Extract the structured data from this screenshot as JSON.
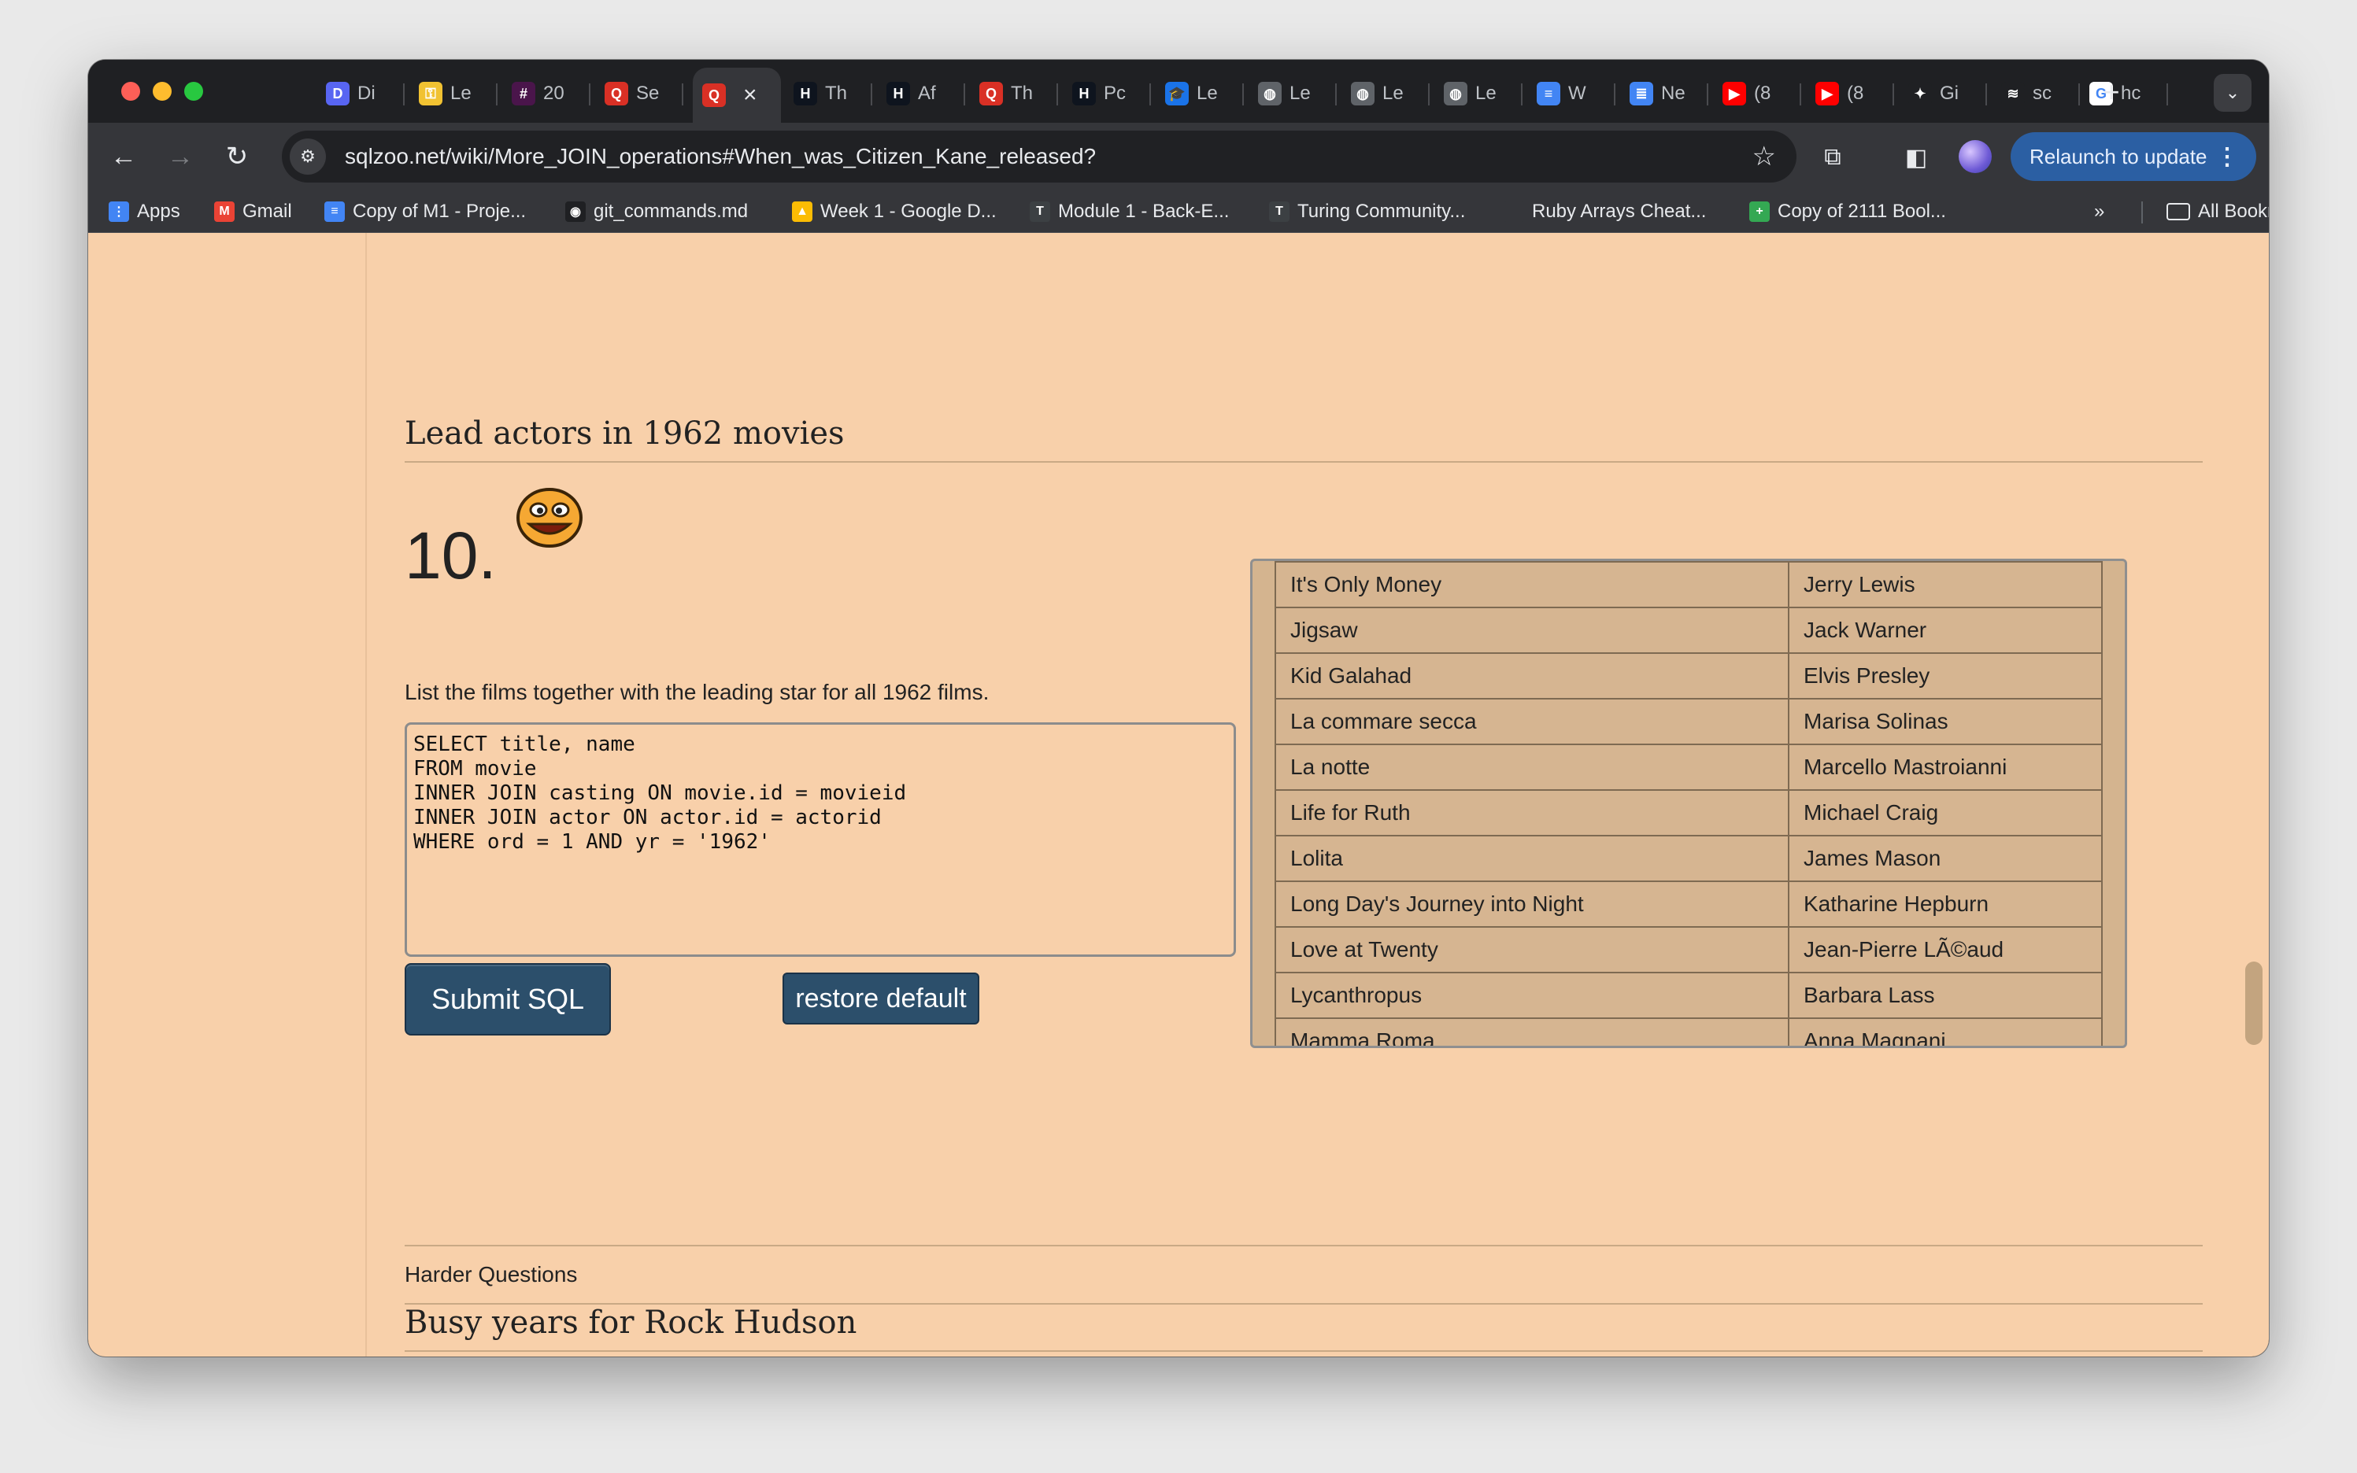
{
  "tabs": [
    {
      "label": "Di",
      "icon": "discord-icon",
      "color": "#5865f2",
      "glyph": "D"
    },
    {
      "label": "Le",
      "icon": "key-icon",
      "color": "#f1c232",
      "glyph": "⚿"
    },
    {
      "label": "20",
      "icon": "slack-icon",
      "color": "#4a154b",
      "glyph": "#"
    },
    {
      "label": "Se",
      "icon": "sqlzoo-icon",
      "color": "#d93025",
      "glyph": "Q"
    },
    {
      "label": "",
      "icon": "sqlzoo-icon",
      "color": "#d93025",
      "glyph": "Q",
      "active": true
    },
    {
      "label": "Th",
      "icon": "hackerrank-icon",
      "color": "#0e141e",
      "glyph": "H"
    },
    {
      "label": "Af",
      "icon": "hackerrank-icon",
      "color": "#0e141e",
      "glyph": "H"
    },
    {
      "label": "Th",
      "icon": "sqlzoo-icon",
      "color": "#d93025",
      "glyph": "Q"
    },
    {
      "label": "Pc",
      "icon": "hackerrank-icon",
      "color": "#0e141e",
      "glyph": "H"
    },
    {
      "label": "Le",
      "icon": "graduation-cap-icon",
      "color": "#1a73e8",
      "glyph": "🎓"
    },
    {
      "label": "Le",
      "icon": "globe-icon",
      "color": "#5f6368",
      "glyph": "◍"
    },
    {
      "label": "Le",
      "icon": "globe-icon",
      "color": "#5f6368",
      "glyph": "◍"
    },
    {
      "label": "Le",
      "icon": "globe-icon",
      "color": "#5f6368",
      "glyph": "◍"
    },
    {
      "label": "W",
      "icon": "google-docs-icon",
      "color": "#4285f4",
      "glyph": "≡"
    },
    {
      "label": "Ne",
      "icon": "database-icon",
      "color": "#4285f4",
      "glyph": "≣"
    },
    {
      "label": "(8",
      "icon": "youtube-icon",
      "color": "#ff0000",
      "glyph": "▶"
    },
    {
      "label": "(8",
      "icon": "youtube-icon",
      "color": "#ff0000",
      "glyph": "▶"
    },
    {
      "label": "Gi",
      "icon": "gemini-icon",
      "color": "#1f2023",
      "glyph": "✦"
    },
    {
      "label": "sc",
      "icon": "stackoverflow-icon",
      "color": "#1f2023",
      "glyph": "≋"
    },
    {
      "label": "hc",
      "icon": "google-icon",
      "color": "#ffffff",
      "glyph": "G"
    }
  ],
  "toolbar": {
    "url": "sqlzoo.net/wiki/More_JOIN_operations#When_was_Citizen_Kane_released?",
    "relaunch_label": "Relaunch to update"
  },
  "bookmarks": [
    {
      "label": "Apps",
      "icon": "apps-grid-icon",
      "color": "#4285f4",
      "glyph": "⋮"
    },
    {
      "label": "Gmail",
      "icon": "gmail-icon",
      "color": "#ea4335",
      "glyph": "M"
    },
    {
      "label": "Copy of M1 - Proje...",
      "icon": "google-docs-icon",
      "color": "#4285f4",
      "glyph": "≡"
    },
    {
      "label": "git_commands.md",
      "icon": "github-icon",
      "color": "#1f2023",
      "glyph": "◉"
    },
    {
      "label": "Week 1 - Google D...",
      "icon": "google-drive-icon",
      "color": "#fbbc04",
      "glyph": "▲"
    },
    {
      "label": "Module 1 - Back-E...",
      "icon": "turing-icon",
      "color": "#3c4043",
      "glyph": "T"
    },
    {
      "label": "Turing Community...",
      "icon": "turing-icon",
      "color": "#3c4043",
      "glyph": "T"
    },
    {
      "label": "Ruby Arrays Cheat...",
      "icon": "blank-page-icon",
      "color": "#35363a",
      "glyph": ""
    },
    {
      "label": "Copy of 2111 Bool...",
      "icon": "google-sheets-icon",
      "color": "#34a853",
      "glyph": "+"
    }
  ],
  "bookmarks_overflow": "»",
  "all_bookmarks_label": "All Bookmarks",
  "content": {
    "section_title": "Lead actors in 1962 movies",
    "question_number": "10.",
    "question_text": "List the films together with the leading star for all 1962 films.",
    "sql": "SELECT title, name\nFROM movie\nINNER JOIN casting ON movie.id = movieid\nINNER JOIN actor ON actor.id = actorid\nWHERE ord = 1 AND yr = '1962'",
    "submit_label": "Submit SQL",
    "restore_label": "restore default",
    "results": [
      [
        "It's Only Money",
        "Jerry Lewis"
      ],
      [
        "Jigsaw",
        "Jack Warner"
      ],
      [
        "Kid Galahad",
        "Elvis Presley"
      ],
      [
        "La commare secca",
        "Marisa Solinas"
      ],
      [
        "La notte",
        "Marcello Mastroianni"
      ],
      [
        "Life for Ruth",
        "Michael Craig"
      ],
      [
        "Lolita",
        "James Mason"
      ],
      [
        "Long Day's Journey into Night",
        "Katharine Hepburn"
      ],
      [
        "Love at Twenty",
        "Jean-Pierre LÃ©aud"
      ],
      [
        "Lycanthropus",
        "Barbara Lass"
      ],
      [
        "Mamma Roma",
        "Anna Magnani"
      ]
    ],
    "harder_label": "Harder Questions",
    "next_section_title": "Busy years for Rock Hudson"
  }
}
